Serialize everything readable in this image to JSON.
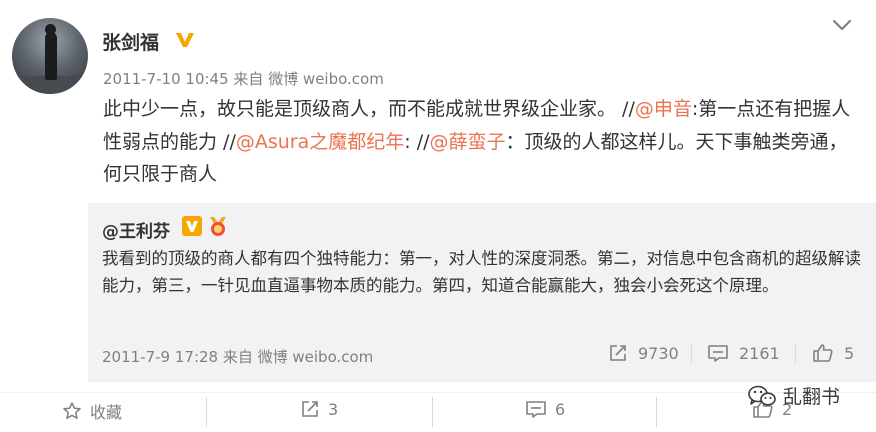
{
  "post": {
    "username": "张剑福",
    "meta": "2011-7-10 10:45 来自 微博 weibo.com",
    "text_parts": [
      "此中少一点，故只能是顶级商人，而不能成就世界级企业家。 //",
      "@申音",
      ":第一点还有把握人性弱点的能力 //",
      "@Asura之魔都纪年",
      ": //",
      "@薛蛮子",
      "：顶级的人都这样儿。天下事触类旁通，何只限于商人"
    ]
  },
  "repost": {
    "username": "@王利芬",
    "text": "我看到的顶级的商人都有四个独特能力：第一，对人性的深度洞悉。第二，对信息中包含商机的超级解读能力，第三，一针见血直逼事物本质的能力。第四，知道合能赢能大，独会小会死这个原理。",
    "meta": "2011-7-9 17:28 来自 微博 weibo.com",
    "reposts": "9730",
    "comments": "2161",
    "likes": "5"
  },
  "actions": {
    "favorite_label": "收藏",
    "repost_count": "3",
    "comment_count": "6",
    "like_count": "2"
  },
  "watermark": {
    "text": "乱翻书"
  },
  "colors": {
    "mention": "#eb7350",
    "verified": "#f7a600",
    "meta_gray": "#808080",
    "repost_bg": "#f2f2f5"
  },
  "icons": [
    "verified-v-icon",
    "chevron-down-icon",
    "medal-icon",
    "repost-icon",
    "comment-icon",
    "thumbs-up-icon",
    "star-icon",
    "wechat-icon"
  ]
}
